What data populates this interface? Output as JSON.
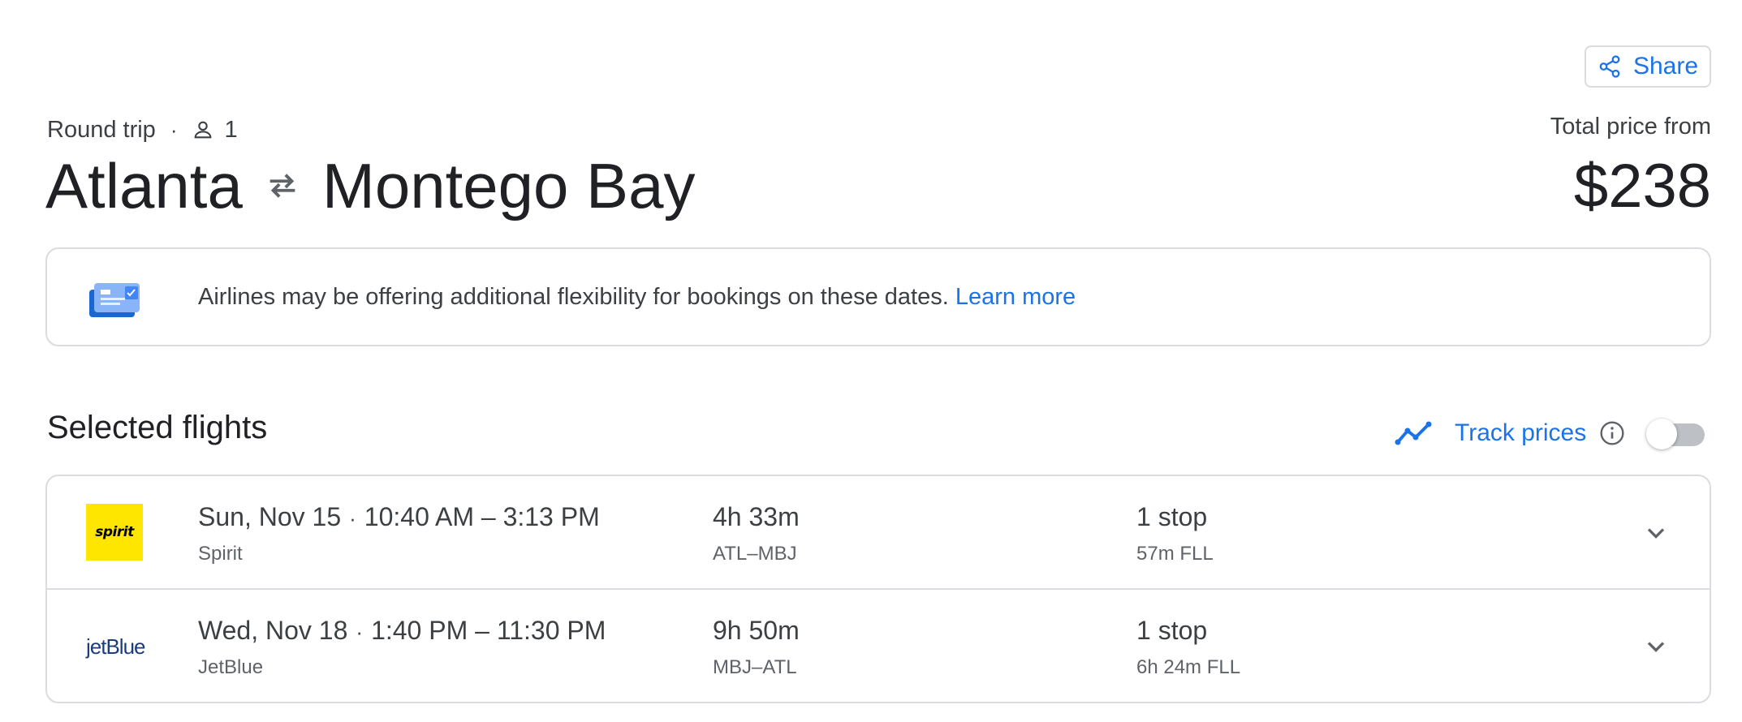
{
  "header": {
    "share_label": "Share",
    "trip_type": "Round trip",
    "passengers": "1",
    "origin": "Atlanta",
    "destination": "Montego Bay",
    "price_label": "Total price from",
    "price": "$238"
  },
  "notice": {
    "text": "Airlines may be offering additional flexibility for bookings on these dates. ",
    "link": "Learn more"
  },
  "selected_flights": {
    "title": "Selected flights",
    "track_label": "Track prices",
    "track_enabled": false,
    "flights": [
      {
        "airline_logo": "spirit",
        "date": "Sun, Nov 15",
        "times": "10:40 AM – 3:13 PM",
        "airline": "Spirit",
        "duration": "4h 33m",
        "route": "ATL–MBJ",
        "stops": "1 stop",
        "layover": "57m FLL"
      },
      {
        "airline_logo": "jetBlue",
        "date": "Wed, Nov 18",
        "times": "1:40 PM – 11:30 PM",
        "airline": "JetBlue",
        "duration": "9h 50m",
        "route": "MBJ–ATL",
        "stops": "1 stop",
        "layover": "6h 24m FLL"
      }
    ]
  },
  "colors": {
    "accent": "#1a73e8",
    "border": "#dadce0",
    "text_primary": "#202124",
    "text_secondary": "#5f6368",
    "spirit_yellow": "#ffe600",
    "jetblue_navy": "#1d3c7a"
  },
  "icons": [
    "share-icon",
    "person-icon",
    "swap-arrows-icon",
    "flexible-booking-icon",
    "trend-line-icon",
    "info-icon",
    "chevron-down-icon"
  ]
}
